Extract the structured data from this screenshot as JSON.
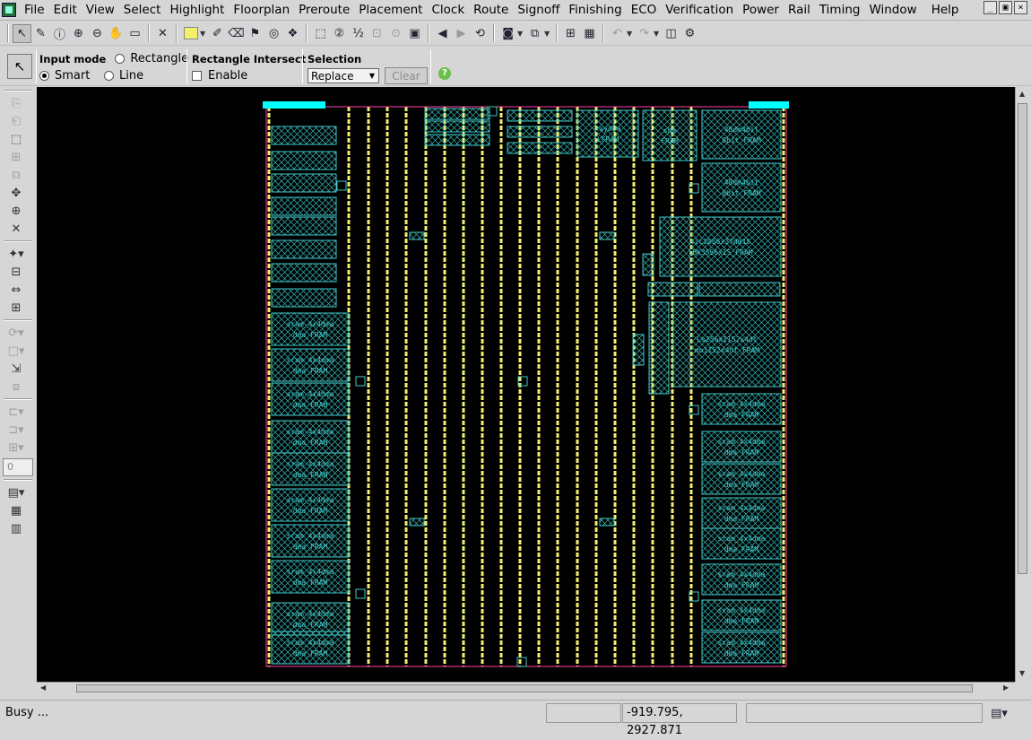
{
  "menubar": {
    "items": [
      {
        "name": "menu-file",
        "label": "File"
      },
      {
        "name": "menu-edit",
        "label": "Edit"
      },
      {
        "name": "menu-view",
        "label": "View"
      },
      {
        "name": "menu-select",
        "label": "Select"
      },
      {
        "name": "menu-highlight",
        "label": "Highlight"
      },
      {
        "name": "menu-floorplan",
        "label": "Floorplan"
      },
      {
        "name": "menu-preroute",
        "label": "Preroute"
      },
      {
        "name": "menu-placement",
        "label": "Placement"
      },
      {
        "name": "menu-clock",
        "label": "Clock"
      },
      {
        "name": "menu-route",
        "label": "Route"
      },
      {
        "name": "menu-signoff",
        "label": "Signoff"
      },
      {
        "name": "menu-finishing",
        "label": "Finishing"
      },
      {
        "name": "menu-eco",
        "label": "ECO"
      },
      {
        "name": "menu-verification",
        "label": "Verification"
      },
      {
        "name": "menu-power",
        "label": "Power"
      },
      {
        "name": "menu-rail",
        "label": "Rail"
      },
      {
        "name": "menu-timing",
        "label": "Timing"
      },
      {
        "name": "menu-window",
        "label": "Window"
      }
    ],
    "help_label": "Help",
    "window_controls": [
      "_",
      "▣",
      "×"
    ]
  },
  "options": {
    "input_mode_title": "Input mode",
    "rectangle_label": "Rectangle",
    "smart_label": "Smart",
    "line_label": "Line",
    "rect_intersect_title": "Rectangle Intersect",
    "enable_label": "Enable",
    "selection_title": "Selection",
    "selection_value": "Replace",
    "clear_label": "Clear",
    "help_glyph": "?"
  },
  "lefttools": {
    "field_value": "0"
  },
  "layout_view": {
    "colors": {
      "background": "#000000",
      "macro": "#41c9c9",
      "power_stripe": "#f5ef6e",
      "boundary": "#ff3ea5",
      "pin": "#00ffff"
    },
    "macro_labels": {
      "sram_left_a": "sram_4x4dma",
      "sram_left_b": "dma_FRAM",
      "top_mid_a": "xxydba",
      "top_mid_b": "LFRAM",
      "top_mid_c": "sba",
      "top_mid_d": "FRAM",
      "right_top_a": "48dm4bit",
      "right_top_b": "8bit_FRAM",
      "right_big_a": "sic2056x37dm1S",
      "right_big_b": "lBK3S56x1S_FRAM",
      "right_center_a": "Lo256x1152x4dt",
      "right_center_b": "mo1152x4dt_FRAM"
    }
  },
  "statusbar": {
    "status": "Busy ...",
    "coordinates": "-919.795, 2927.871"
  }
}
